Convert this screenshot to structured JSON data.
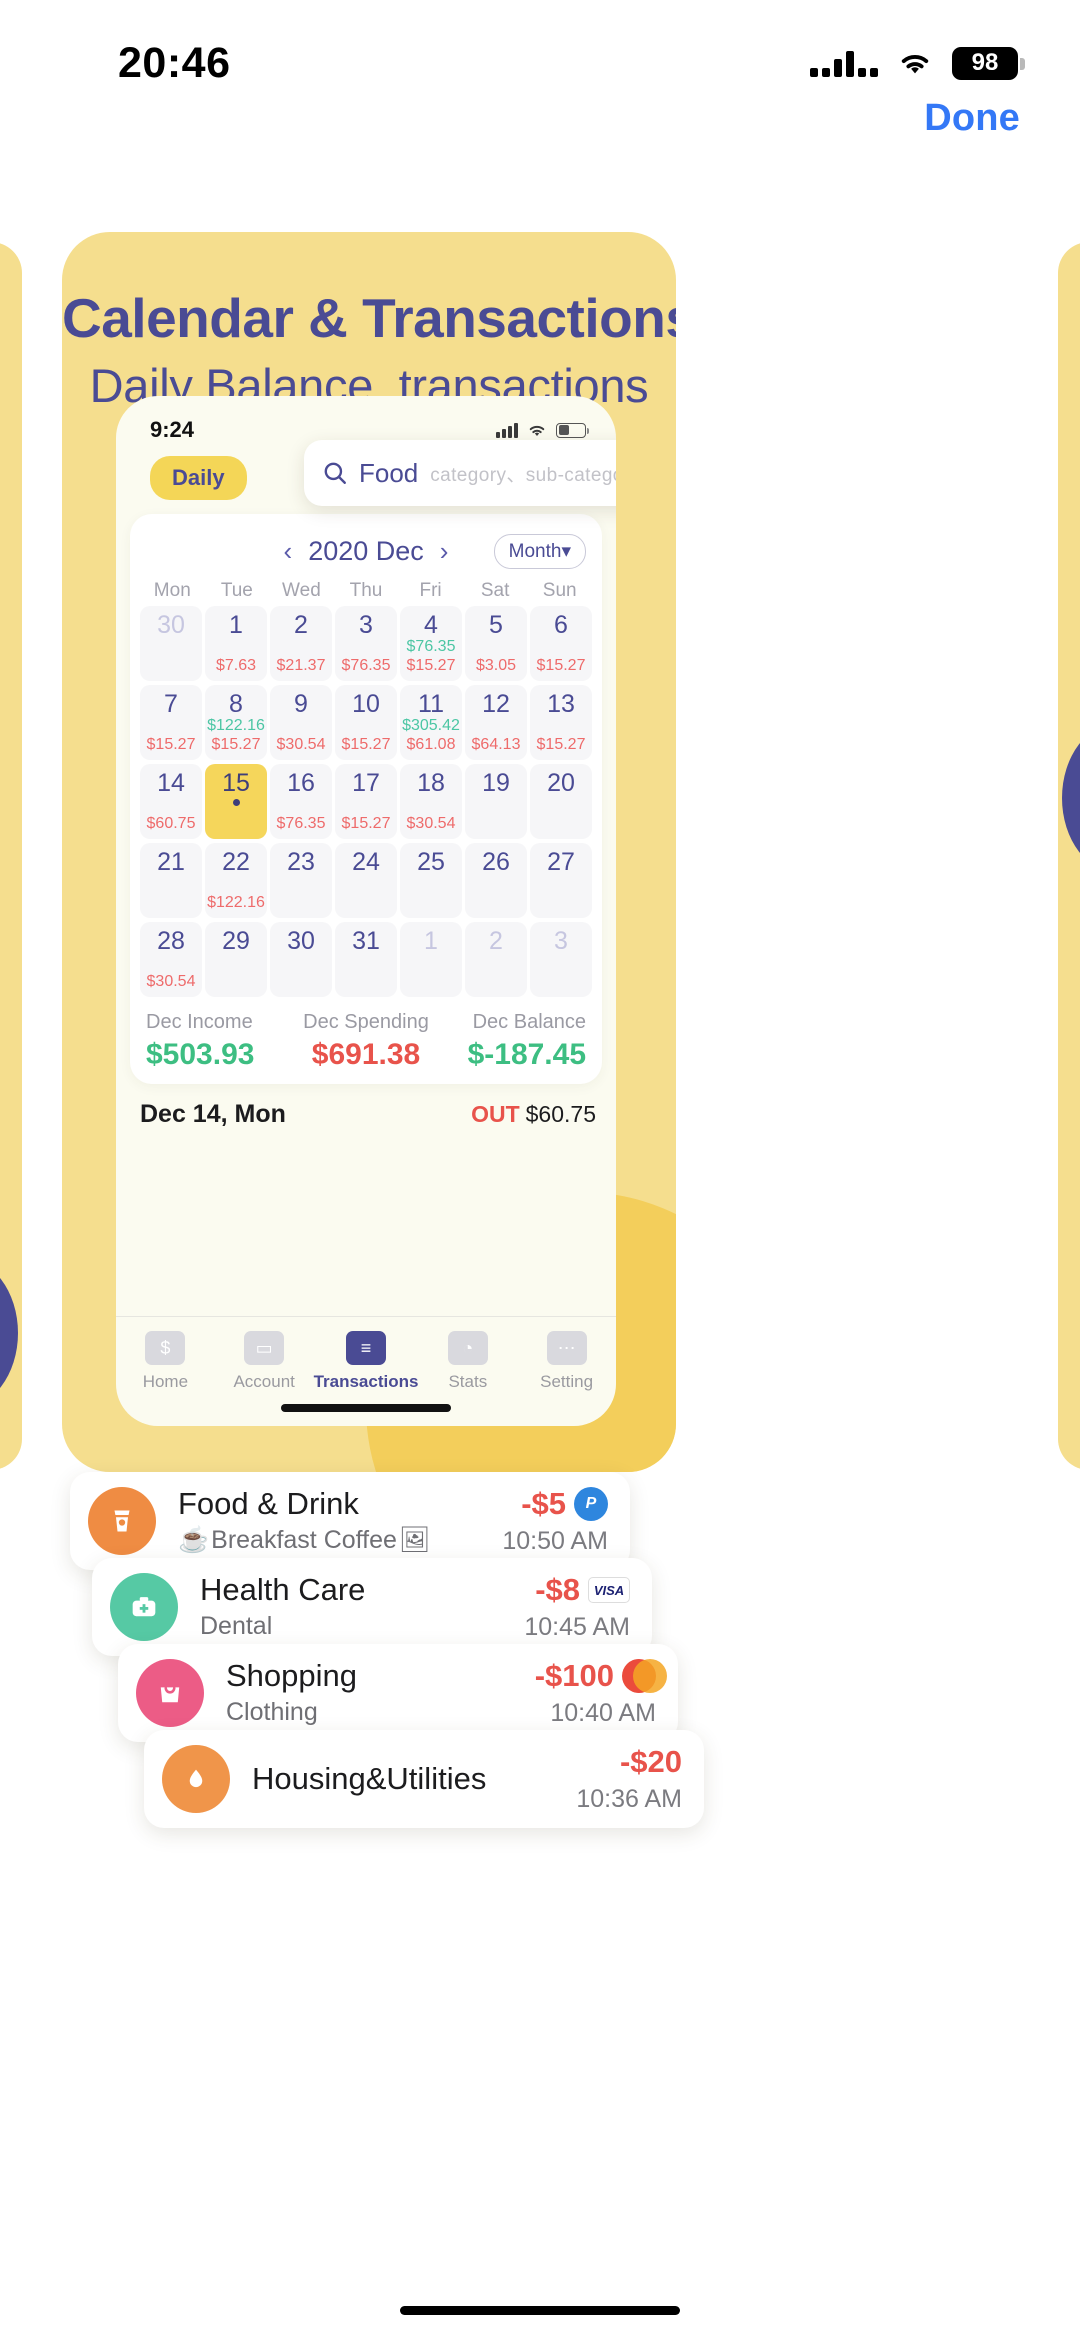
{
  "status_bar": {
    "time": "20:46",
    "battery": "98",
    "signal_icon": "cellular-bars-icon",
    "wifi_icon": "wifi-icon",
    "battery_icon": "battery-icon"
  },
  "nav": {
    "done_label": "Done"
  },
  "card": {
    "title": "Calendar & Transactions",
    "subtitle": "Daily Balance, transactions",
    "bg_color": "#F5DE8E",
    "title_color": "#4A4B94"
  },
  "phone": {
    "status": {
      "time": "9:24"
    },
    "daily_pill": "Daily",
    "search": {
      "value": "Food",
      "placeholder": "category、sub-category、notes",
      "icon": "search-icon"
    },
    "calendar": {
      "prev_icon": "chevron-left-icon",
      "next_icon": "chevron-right-icon",
      "month_label": "2020 Dec",
      "mode_label": "Month",
      "dow": [
        "Mon",
        "Tue",
        "Wed",
        "Thu",
        "Fri",
        "Sat",
        "Sun"
      ],
      "days": [
        {
          "n": "30",
          "muted": true
        },
        {
          "n": "1",
          "out": "$7.63"
        },
        {
          "n": "2",
          "out": "$21.37"
        },
        {
          "n": "3",
          "out": "$76.35"
        },
        {
          "n": "4",
          "in": "$76.35",
          "out": "$15.27"
        },
        {
          "n": "5",
          "out": "$3.05"
        },
        {
          "n": "6",
          "out": "$15.27"
        },
        {
          "n": "7",
          "out": "$15.27"
        },
        {
          "n": "8",
          "in": "$122.16",
          "out": "$15.27"
        },
        {
          "n": "9",
          "out": "$30.54"
        },
        {
          "n": "10",
          "out": "$15.27"
        },
        {
          "n": "11",
          "in": "$305.42",
          "out": "$61.08"
        },
        {
          "n": "12",
          "out": "$64.13"
        },
        {
          "n": "13",
          "out": "$15.27"
        },
        {
          "n": "14",
          "out": "$60.75"
        },
        {
          "n": "15",
          "selected": true
        },
        {
          "n": "16",
          "out": "$76.35"
        },
        {
          "n": "17",
          "out": "$15.27"
        },
        {
          "n": "18",
          "out": "$30.54"
        },
        {
          "n": "19"
        },
        {
          "n": "20"
        },
        {
          "n": "21"
        },
        {
          "n": "22",
          "out": "$122.16"
        },
        {
          "n": "23"
        },
        {
          "n": "24"
        },
        {
          "n": "25"
        },
        {
          "n": "26"
        },
        {
          "n": "27"
        },
        {
          "n": "28",
          "out": "$30.54"
        },
        {
          "n": "29"
        },
        {
          "n": "30"
        },
        {
          "n": "31"
        },
        {
          "n": "1",
          "muted": true
        },
        {
          "n": "2",
          "muted": true
        },
        {
          "n": "3",
          "muted": true
        }
      ],
      "summary": [
        {
          "label": "Dec Income",
          "value": "$503.93",
          "tone": "green"
        },
        {
          "label": "Dec Spending",
          "value": "$691.38",
          "tone": "red"
        },
        {
          "label": "Dec Balance",
          "value": "$-187.45",
          "tone": "green"
        }
      ]
    },
    "day_header": {
      "title": "Dec 14, Mon",
      "flag": "OUT",
      "amount": "$60.75"
    },
    "transactions": [
      {
        "category": "Food & Drink",
        "note": "Breakfast Coffee",
        "note_emoji": "☕",
        "has_photo": true,
        "amount": "-$5",
        "time": "10:50 AM",
        "pay": "paypal",
        "pay_label": "P",
        "icon": "coffee-cup-icon",
        "color": "#EF8C43"
      },
      {
        "category": "Health Care",
        "note": "Dental",
        "note_emoji": "",
        "has_photo": false,
        "amount": "-$8",
        "time": "10:45 AM",
        "pay": "visa",
        "pay_label": "VISA",
        "icon": "medical-kit-icon",
        "color": "#56C9A4"
      },
      {
        "category": "Shopping",
        "note": "Clothing",
        "note_emoji": "",
        "has_photo": false,
        "amount": "-$100",
        "time": "10:40 AM",
        "pay": "mc",
        "pay_label": "",
        "icon": "shopping-bag-icon",
        "color": "#EC5C86"
      },
      {
        "category": "Housing&Utilities",
        "note": "",
        "note_emoji": "",
        "has_photo": false,
        "amount": "-$20",
        "time": "10:36 AM",
        "pay": "",
        "pay_label": "",
        "icon": "water-drop-icon",
        "color": "#F0954A"
      }
    ],
    "tabs": [
      {
        "label": "Home",
        "icon": "dollar-home-icon",
        "active": false,
        "glyph": "$"
      },
      {
        "label": "Account",
        "icon": "wallet-icon",
        "active": false,
        "glyph": "▭"
      },
      {
        "label": "Transactions",
        "icon": "transactions-icon",
        "active": true,
        "glyph": "≡"
      },
      {
        "label": "Stats",
        "icon": "pie-chart-icon",
        "active": false,
        "glyph": "◔"
      },
      {
        "label": "Setting",
        "icon": "sliders-icon",
        "active": false,
        "glyph": "⋯"
      }
    ]
  }
}
